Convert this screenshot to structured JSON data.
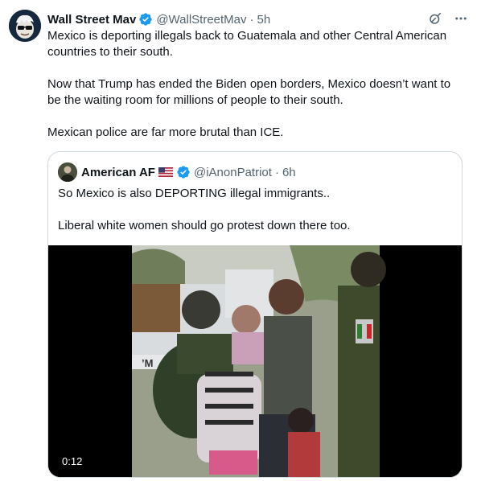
{
  "author": {
    "name": "Wall Street Mav",
    "handle": "@WallStreetMav",
    "separator": "·",
    "time": "5h",
    "avatar_icon": "sunglasses-avatar-icon",
    "verified_color": "#1d9bf0"
  },
  "tweet": {
    "text": "Mexico is deporting illegals back to Guatemala and other Central American countries to their south.\n\nNow that Trump has ended the Biden open borders, Mexico doesn’t want to be the waiting room for millions of people to their south.\n\nMexican police are far more brutal than ICE."
  },
  "actions": {
    "grok_icon": "grok-icon",
    "more_icon": "more-options-icon"
  },
  "quote": {
    "name": "American AF",
    "flag_icon": "us-flag-icon",
    "handle": "@iAnonPatriot",
    "separator": "·",
    "time": "6h",
    "text": "So Mexico is also DEPORTING illegal immigrants..\n\nLiberal white women should go protest down there too.",
    "video": {
      "duration": "0:12",
      "sign_text": "’M"
    }
  }
}
